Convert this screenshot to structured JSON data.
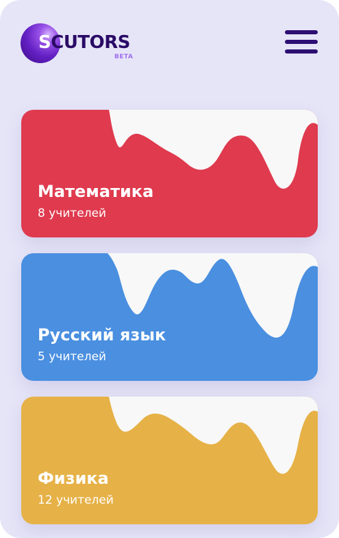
{
  "header": {
    "logo_text_first": "S",
    "logo_text_rest": "CUTORS",
    "logo_badge": "BETA",
    "menu_icon": "hamburger-menu-icon"
  },
  "subjects": [
    {
      "title": "Математика",
      "teachers": "8 учителей",
      "color": "#df3a4e"
    },
    {
      "title": "Русский язык",
      "teachers": "5 учителей",
      "color": "#4a8fe0"
    },
    {
      "title": "Физика",
      "teachers": "12 учителей",
      "color": "#e6b146"
    }
  ],
  "colors": {
    "background": "#e6e5f7",
    "brand_dark": "#2c0f72",
    "brand_purple": "#6420c4",
    "wave": "#f8f8f8"
  }
}
